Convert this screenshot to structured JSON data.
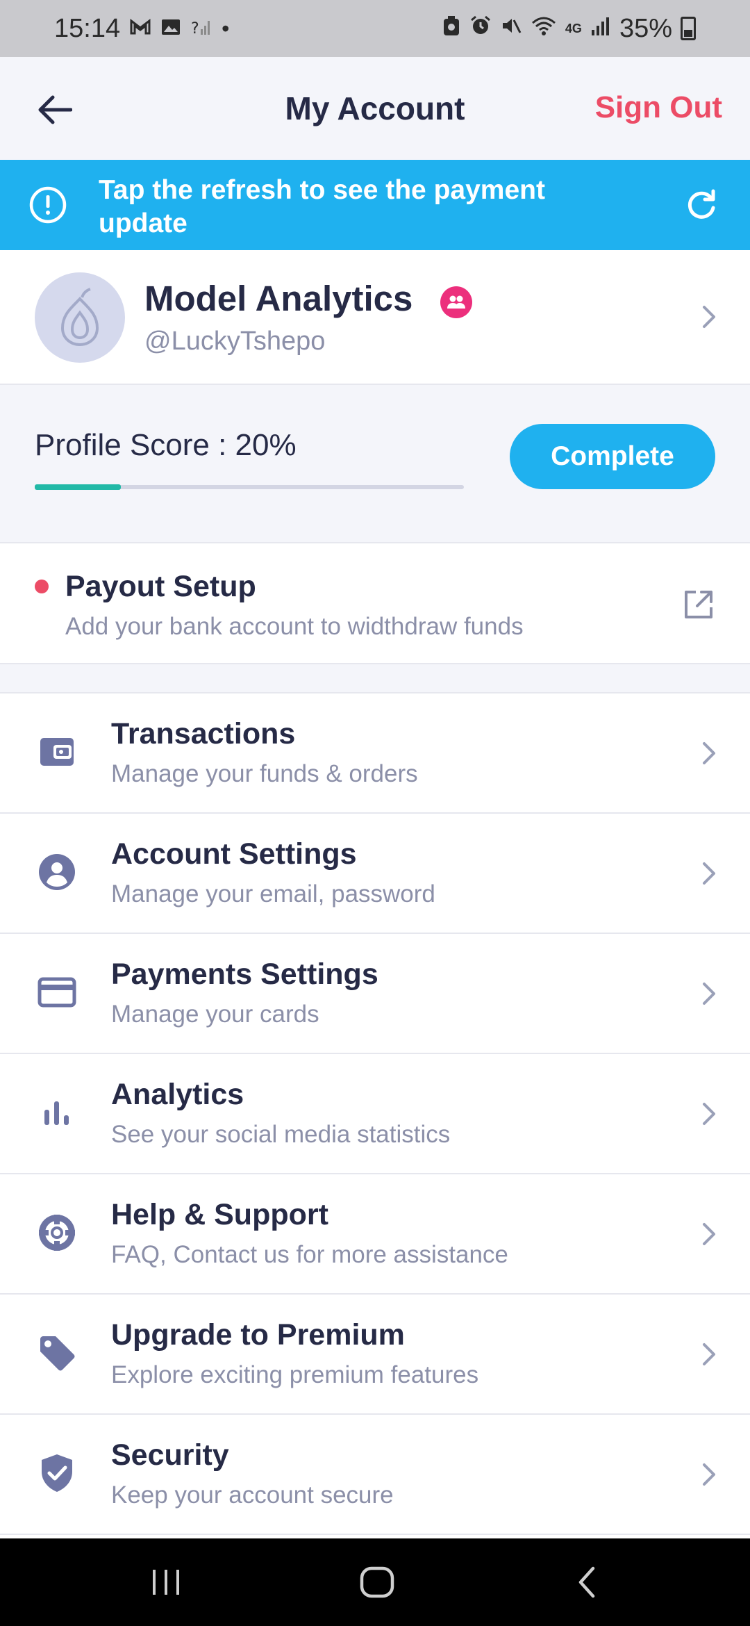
{
  "status_bar": {
    "time": "15:14",
    "left_icons": [
      "gmail-icon",
      "gallery-icon",
      "no-signal-icon",
      "dot-icon"
    ],
    "right_icons": [
      "recycle-icon",
      "alarm-icon",
      "mute-icon",
      "wifi-icon",
      "4g-icon",
      "signal-icon"
    ],
    "network": "4G",
    "battery": "35%"
  },
  "header": {
    "title": "My Account",
    "sign_out": "Sign Out",
    "back_icon": "arrow-left-icon"
  },
  "banner": {
    "text": "Tap the refresh to see the payment update",
    "info_icon": "alert-circle-icon",
    "refresh_icon": "refresh-icon",
    "color": "#1fb1ef"
  },
  "profile": {
    "name": "Model Analytics",
    "handle": "@LuckyTshepo",
    "avatar_icon": "pear-logo-icon",
    "badge_icon": "group-icon",
    "badge_color": "#ec2f7c"
  },
  "score": {
    "label": "Profile Score : 20%",
    "progress": 0.2,
    "button": "Complete",
    "progress_color": "#22b9a7"
  },
  "payout": {
    "title": "Payout Setup",
    "subtitle": "Add your bank account to widthdraw funds",
    "link_icon": "external-link-icon",
    "dot_color": "#ec4c66"
  },
  "menu": [
    {
      "icon": "wallet-icon",
      "title": "Transactions",
      "subtitle": "Manage your funds & orders"
    },
    {
      "icon": "account-circle-icon",
      "title": "Account Settings",
      "subtitle": "Manage your email, password"
    },
    {
      "icon": "credit-card-icon",
      "title": "Payments Settings",
      "subtitle": "Manage your cards"
    },
    {
      "icon": "bar-chart-icon",
      "title": "Analytics",
      "subtitle": "See your social media statistics"
    },
    {
      "icon": "lifebuoy-icon",
      "title": "Help & Support",
      "subtitle": "FAQ, Contact us for more assistance"
    },
    {
      "icon": "tag-icon",
      "title": "Upgrade to Premium",
      "subtitle": "Explore exciting premium features"
    },
    {
      "icon": "shield-check-icon",
      "title": "Security",
      "subtitle": "Keep your account secure"
    }
  ],
  "nav": {
    "recents_icon": "recents-icon",
    "home_icon": "home-icon",
    "back_icon": "back-chevron-icon"
  },
  "colors": {
    "accent": "#1fb1ef",
    "danger": "#ec4c66",
    "text_primary": "#262a46",
    "text_secondary": "#8b8fa8",
    "icon": "#6d74a3"
  }
}
